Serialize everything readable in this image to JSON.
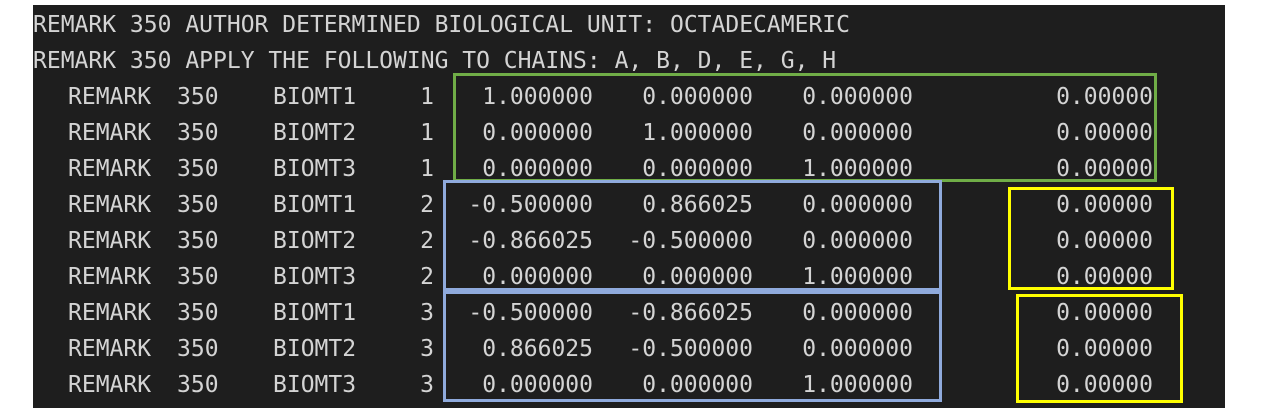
{
  "header_lines": [
    "REMARK 350 AUTHOR DETERMINED BIOLOGICAL UNIT: OCTADECAMERIC",
    "REMARK 350 APPLY THE FOLLOWING TO CHAINS: A, B, D, E, G, H"
  ],
  "rows": [
    {
      "rec": "REMARK",
      "num": "350",
      "name": "BIOMT1",
      "idx": "1",
      "a": "1.000000",
      "b": "0.000000",
      "c": "0.000000",
      "t": "0.00000"
    },
    {
      "rec": "REMARK",
      "num": "350",
      "name": "BIOMT2",
      "idx": "1",
      "a": "0.000000",
      "b": "1.000000",
      "c": "0.000000",
      "t": "0.00000"
    },
    {
      "rec": "REMARK",
      "num": "350",
      "name": "BIOMT3",
      "idx": "1",
      "a": "0.000000",
      "b": "0.000000",
      "c": "1.000000",
      "t": "0.00000"
    },
    {
      "rec": "REMARK",
      "num": "350",
      "name": "BIOMT1",
      "idx": "2",
      "a": "-0.500000",
      "b": "0.866025",
      "c": "0.000000",
      "t": "0.00000"
    },
    {
      "rec": "REMARK",
      "num": "350",
      "name": "BIOMT2",
      "idx": "2",
      "a": "-0.866025",
      "b": "-0.500000",
      "c": "0.000000",
      "t": "0.00000"
    },
    {
      "rec": "REMARK",
      "num": "350",
      "name": "BIOMT3",
      "idx": "2",
      "a": "0.000000",
      "b": "0.000000",
      "c": "1.000000",
      "t": "0.00000"
    },
    {
      "rec": "REMARK",
      "num": "350",
      "name": "BIOMT1",
      "idx": "3",
      "a": "-0.500000",
      "b": "-0.866025",
      "c": "0.000000",
      "t": "0.00000"
    },
    {
      "rec": "REMARK",
      "num": "350",
      "name": "BIOMT2",
      "idx": "3",
      "a": "0.866025",
      "b": "-0.500000",
      "c": "0.000000",
      "t": "0.00000"
    },
    {
      "rec": "REMARK",
      "num": "350",
      "name": "BIOMT3",
      "idx": "3",
      "a": "0.000000",
      "b": "0.000000",
      "c": "1.000000",
      "t": "0.00000"
    }
  ],
  "colors": {
    "background": "#1e1e1e",
    "text": "#d4d4d4",
    "box_identity": "#70ad47",
    "box_rotation": "#8faadc",
    "box_translation": "#ffff00"
  }
}
